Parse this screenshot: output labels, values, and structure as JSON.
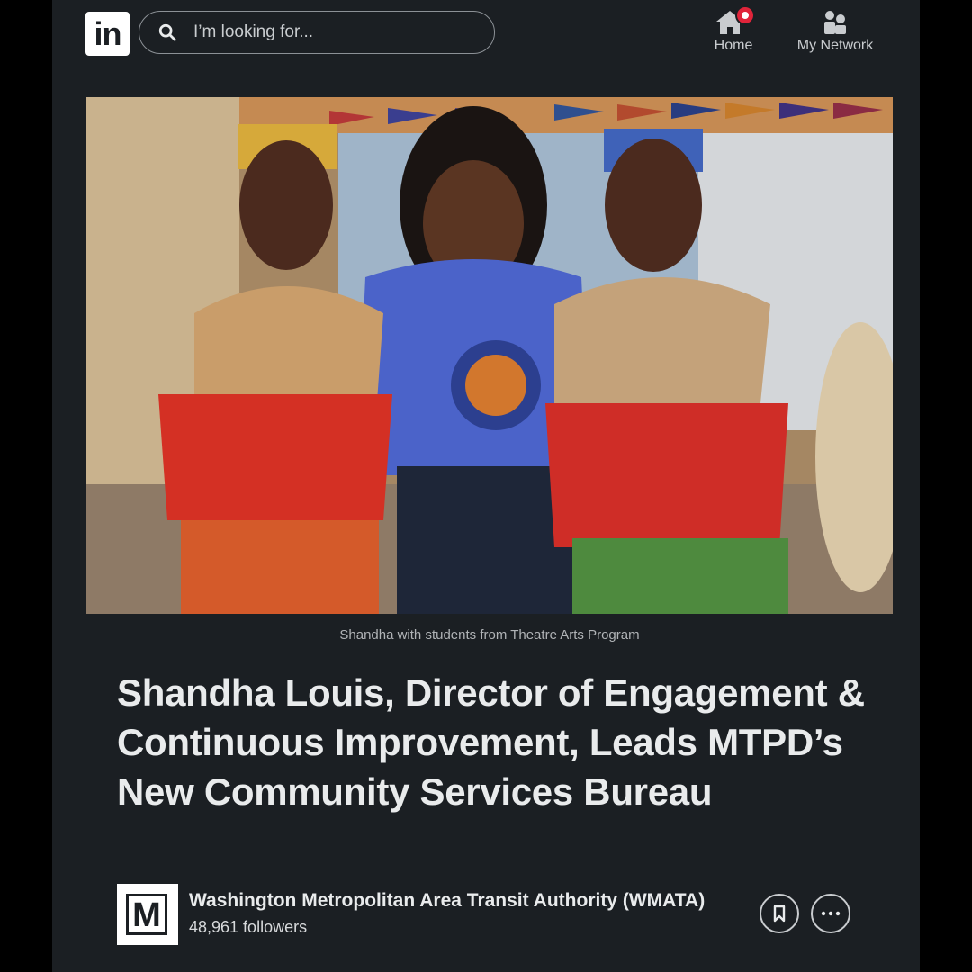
{
  "header": {
    "logo_text": "in",
    "search": {
      "placeholder": "I’m looking for..."
    },
    "nav": {
      "home_label": "Home",
      "network_label": "My Network"
    }
  },
  "article": {
    "image_caption": "Shandha with students from Theatre Arts Program",
    "headline": "Shandha Louis, Director of Engagement & Continuous Improvement, Leads MTPD’s New Community Services Bureau",
    "author": {
      "logo_text": "M",
      "name": "Washington Metropolitan Area Transit Authority (WMATA)",
      "followers": "48,961 followers"
    }
  },
  "colors": {
    "background": "#1b1f23",
    "notification_badge": "#e0243a",
    "text_primary": "#e9ebec",
    "text_secondary": "#b0b3b6"
  }
}
